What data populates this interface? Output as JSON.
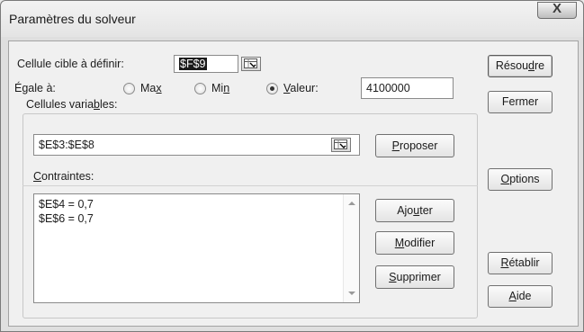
{
  "window": {
    "title": "Paramètres du solveur",
    "close_glyph": "X"
  },
  "target": {
    "label": "Cellule cible à définir:",
    "value": "$F$9"
  },
  "equal": {
    "label": "Égale à:",
    "max": {
      "pre": "Ma",
      "acc": "x",
      "post": "",
      "selected": false
    },
    "min": {
      "pre": "Mi",
      "acc": "n",
      "post": "",
      "selected": false
    },
    "valeur": {
      "pre": "",
      "acc": "V",
      "post": "aleur:",
      "selected": true
    },
    "value_input": "4100000"
  },
  "variables": {
    "label_pre": "Cellules varia",
    "label_acc": "b",
    "label_post": "les:",
    "value": "$E$3:$E$8",
    "propose": {
      "pre": "",
      "acc": "P",
      "post": "roposer"
    }
  },
  "constraints": {
    "label_pre": "",
    "label_acc": "C",
    "label_post": "ontraintes:",
    "items": [
      "$E$4 = 0,7",
      "$E$6 = 0,7"
    ],
    "add": {
      "pre": "Ajo",
      "acc": "u",
      "post": "ter"
    },
    "modify": {
      "pre": "",
      "acc": "M",
      "post": "odifier"
    },
    "delete": {
      "pre": "",
      "acc": "S",
      "post": "upprimer"
    }
  },
  "buttons": {
    "solve": {
      "pre": "Résou",
      "acc": "d",
      "post": "re"
    },
    "close": {
      "label": "Fermer"
    },
    "options": {
      "pre": "",
      "acc": "O",
      "post": "ptions"
    },
    "reset": {
      "pre": "",
      "acc": "R",
      "post": "établir"
    },
    "help": {
      "pre": "",
      "acc": "A",
      "post": "ide"
    }
  },
  "icons": {
    "range_ref": "range-select-icon",
    "scroll_up": "scroll-up-arrow-icon",
    "scroll_down": "scroll-down-arrow-icon"
  }
}
